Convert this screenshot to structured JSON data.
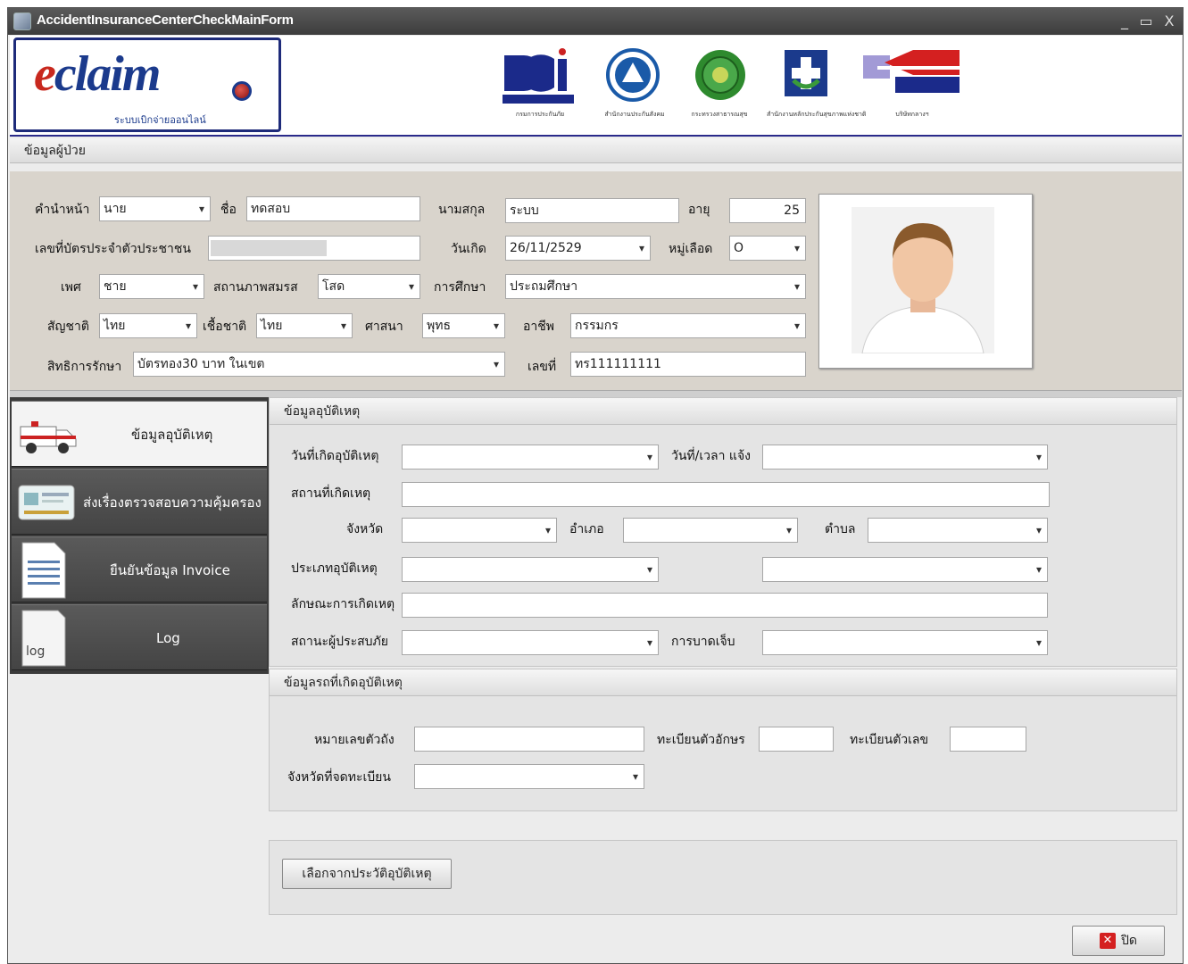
{
  "window": {
    "title": "AccidentInsuranceCenterCheckMainForm",
    "min": "_",
    "max": "▭",
    "close": "X"
  },
  "banner": {
    "logo_text_e": "e",
    "logo_text_rest": "claim",
    "logo_sub": "ระบบเบิกจ่ายออนไลน์",
    "agencies": [
      "กรมการประกันภัย",
      "สำนักงานประกันสังคม",
      "กระทรวงสาธารณสุข",
      "สำนักงานหลักประกันสุขภาพแห่งชาติ",
      "บริษัทกลางฯ"
    ]
  },
  "patient": {
    "section_title": "ข้อมูลผู้ป่วย",
    "prefix_label": "คำนำหน้า",
    "prefix_value": "นาย",
    "first_name_label": "ชื่อ",
    "first_name_value": "ทดสอบ",
    "last_name_label": "นามสกุล",
    "last_name_value": "ระบบ",
    "age_label": "อายุ",
    "age_value": "25",
    "id_card_label": "เลขที่บัตรประจำตัวประชาชน",
    "dob_label": "วันเกิด",
    "dob_value": "26/11/2529",
    "blood_label": "หมู่เลือด",
    "blood_value": "O",
    "sex_label": "เพศ",
    "sex_value": "ชาย",
    "marital_label": "สถานภาพสมรส",
    "marital_value": "โสด",
    "education_label": "การศึกษา",
    "education_value": "ประถมศึกษา",
    "nationality_label": "สัญชาติ",
    "nationality_value": "ไทย",
    "race_label": "เชื้อชาติ",
    "race_value": "ไทย",
    "religion_label": "ศาสนา",
    "religion_value": "พุทธ",
    "occupation_label": "อาชีพ",
    "occupation_value": "กรรมกร",
    "rights_label": "สิทธิการรักษา",
    "rights_value": "บัตรทอง30 บาท  ในเขต",
    "number_label": "เลขที่",
    "number_value": "ทร111111111"
  },
  "nav": {
    "items": [
      {
        "label": "ข้อมูลอุบัติเหตุ",
        "icon": "ambulance-icon"
      },
      {
        "label": "ส่งเรื่องตรวจสอบความคุ้มครอง",
        "icon": "id-card-icon"
      },
      {
        "label": "ยืนยันข้อมูล Invoice",
        "icon": "invoice-document-icon"
      },
      {
        "label": "Log",
        "icon": "log-file-icon",
        "icon_text": "log"
      }
    ]
  },
  "accident": {
    "section_title": "ข้อมูลอุบัติเหตุ",
    "date_label": "วันที่เกิดอุบัติเหตุ",
    "report_label": "วันที่/เวลา แจ้ง",
    "place_label": "สถานที่เกิดเหตุ",
    "province_label": "จังหวัด",
    "district_label": "อำเภอ",
    "subdistrict_label": "ตำบล",
    "type_label": "ประเภทอุบัติเหตุ",
    "nature_label": "ลักษณะการเกิดเหตุ",
    "victim_status_label": "สถานะผู้ประสบภัย",
    "injury_label": "การบาดเจ็บ"
  },
  "vehicle": {
    "section_title": "ข้อมูลรถที่เกิดอุบัติเหตุ",
    "chassis_label": "หมายเลขตัวถัง",
    "plate_letters_label": "ทะเบียนตัวอักษร",
    "plate_numbers_label": "ทะเบียนตัวเลข",
    "reg_province_label": "จังหวัดที่จดทะเบียน"
  },
  "actions": {
    "history_button": "เลือกจากประวัติอุบัติเหตุ",
    "close_button": "ปิด"
  }
}
